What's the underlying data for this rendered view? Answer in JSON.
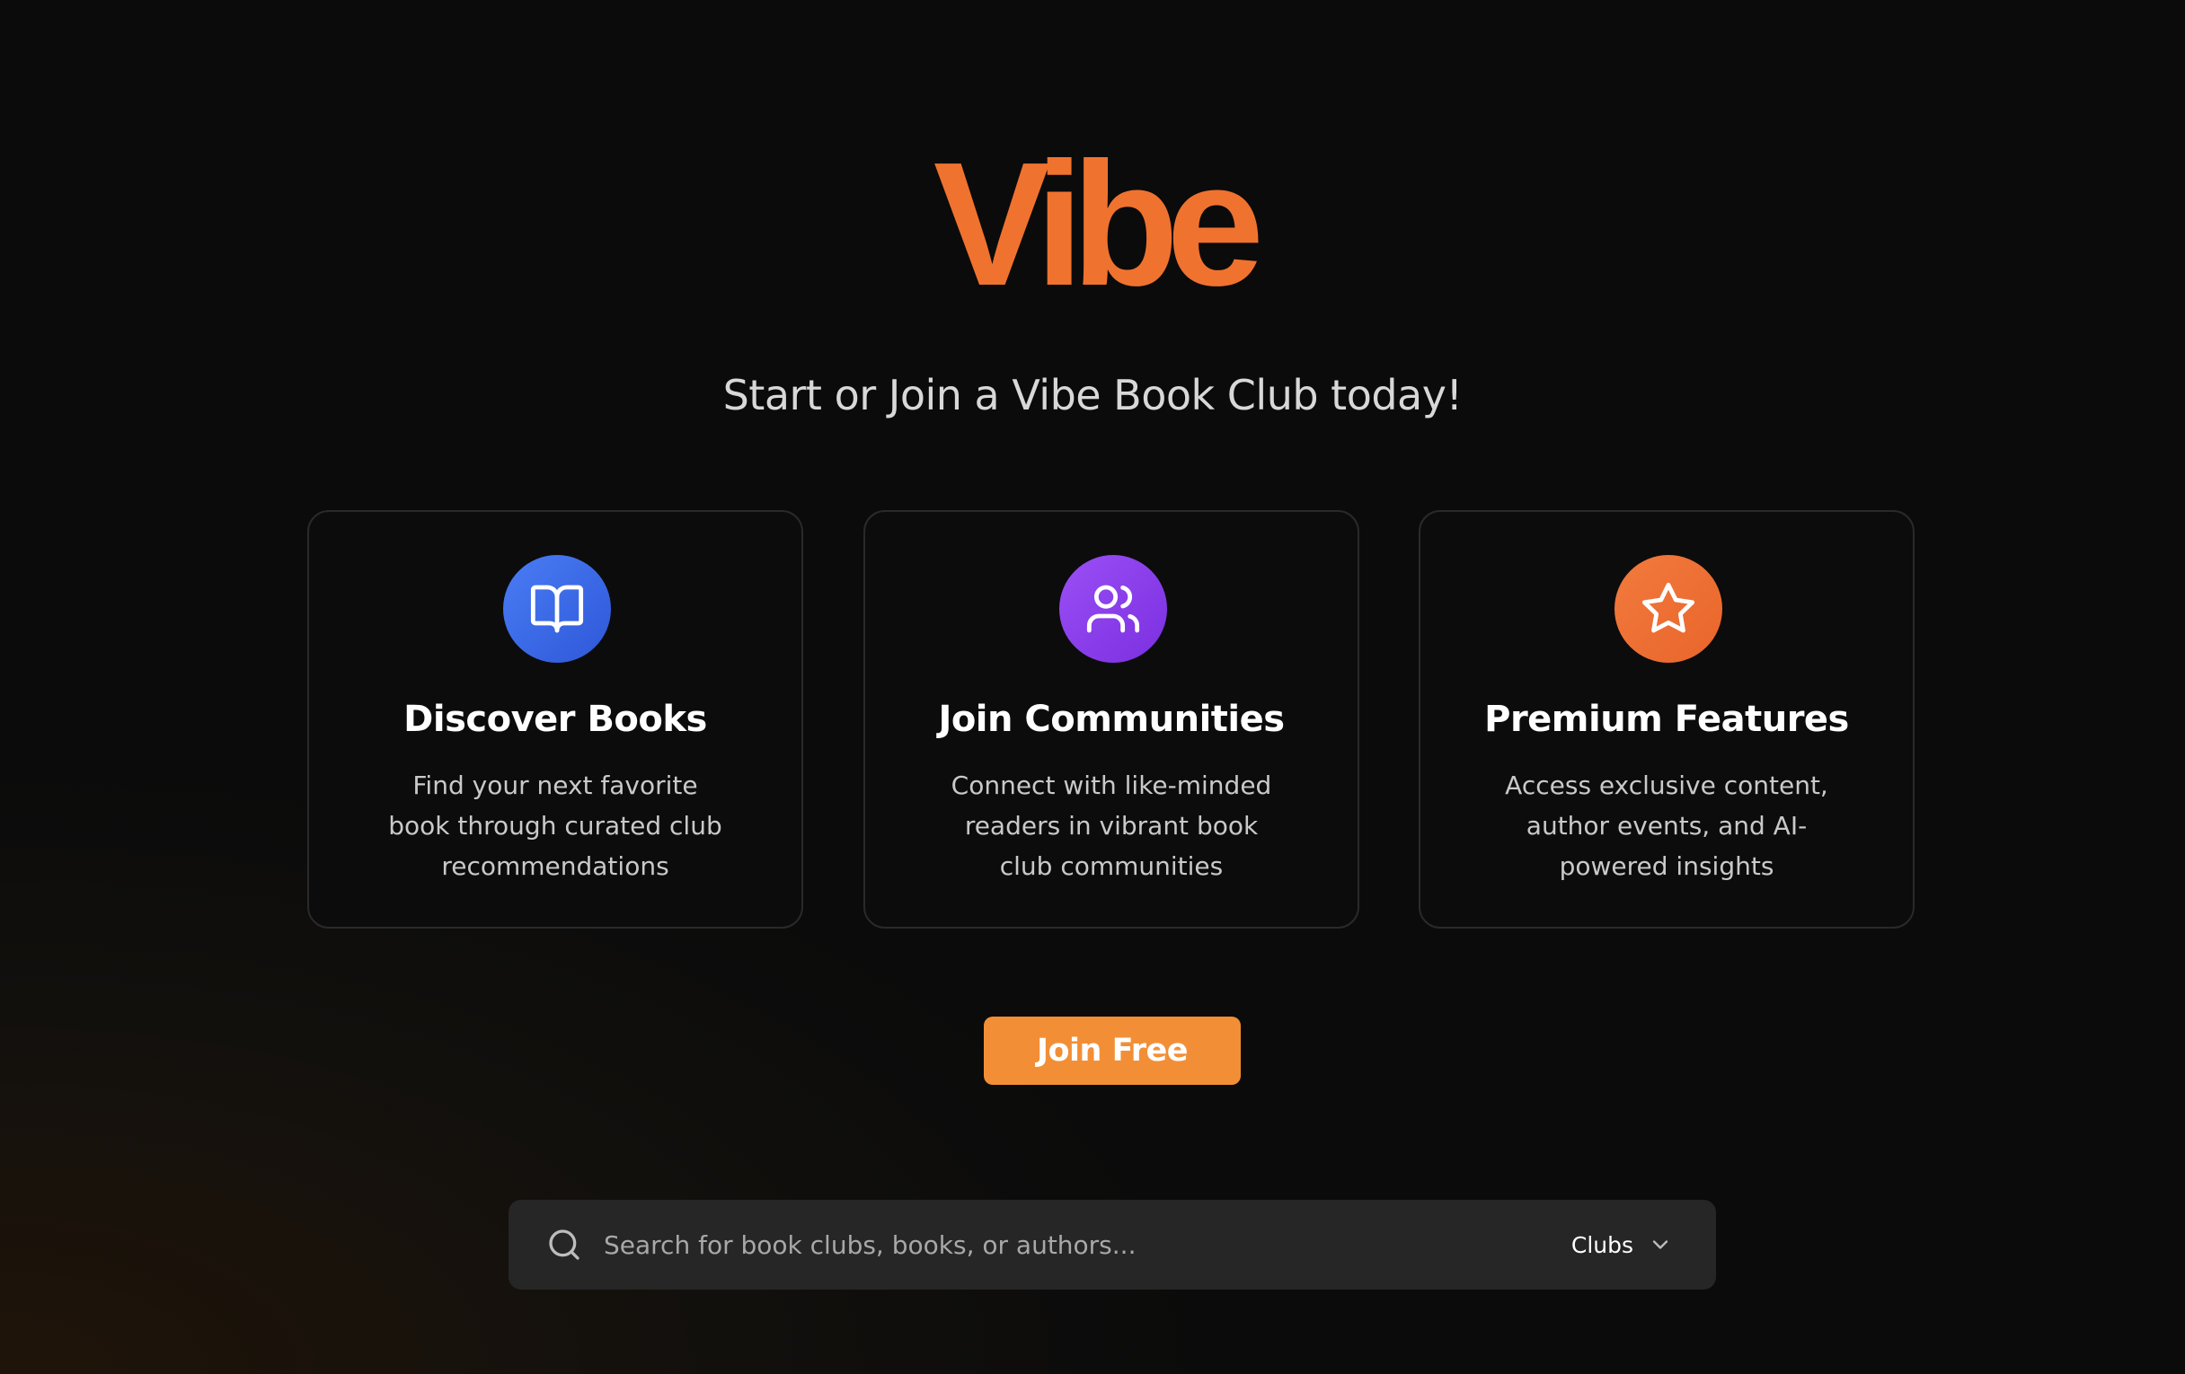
{
  "brand": {
    "logo_text": "Vibe",
    "accent_color": "#f0722f"
  },
  "hero": {
    "tagline": "Start or Join a Vibe Book Club today!"
  },
  "features": [
    {
      "icon": "book-open-icon",
      "color": "#3d6ae8",
      "title": "Discover Books",
      "description": "Find your next favorite book through curated club recommendations"
    },
    {
      "icon": "users-icon",
      "color": "#8a3ee9",
      "title": "Join Communities",
      "description": "Connect with like-minded readers in vibrant book club communities"
    },
    {
      "icon": "star-icon",
      "color": "#ee6f35",
      "title": "Premium Features",
      "description": "Access exclusive content, author events, and AI-powered insights"
    }
  ],
  "cta": {
    "join_label": "Join Free",
    "color": "#f28f36"
  },
  "search": {
    "placeholder": "Search for book clubs, books, or authors...",
    "value": "",
    "filter_selected": "Clubs"
  }
}
